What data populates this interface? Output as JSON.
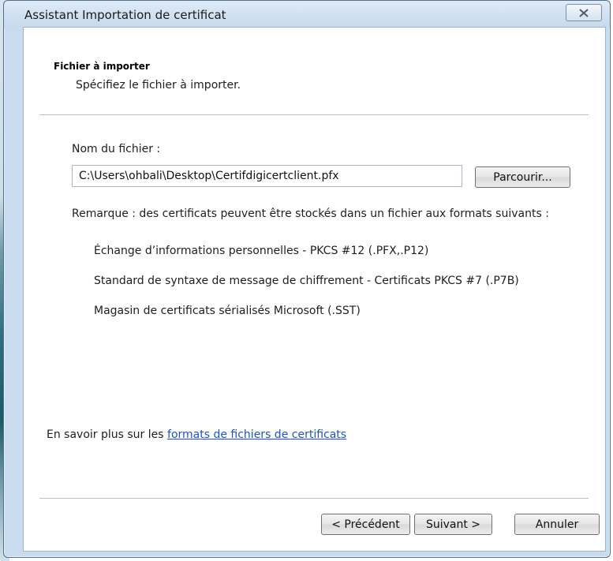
{
  "window": {
    "title": "Assistant Importation de certificat"
  },
  "header": {
    "title": "Fichier à importer",
    "subtitle": "Spécifiez le fichier à importer."
  },
  "form": {
    "file_label": "Nom du fichier :",
    "file_value": "C:\\Users\\ohbali\\Desktop\\Certifdigicertclient.pfx",
    "browse_label": "Parcourir..."
  },
  "note": {
    "text": "Remarque : des certificats peuvent être stockés dans un fichier aux formats suivants :",
    "formats": [
      "Échange d’informations personnelles - PKCS #12 (.PFX,.P12)",
      "Standard de syntaxe de message de chiffrement - Certificats PKCS #7 (.P7B)",
      "Magasin de certificats sérialisés Microsoft (.SST)"
    ]
  },
  "learn_more": {
    "prefix": "En savoir plus sur les ",
    "link_text": "formats de fichiers de certificats"
  },
  "footer": {
    "prev_label": "< Précédent",
    "next_label": "Suivant >",
    "cancel_label": "Annuler"
  },
  "icons": {
    "close": "close-icon"
  }
}
